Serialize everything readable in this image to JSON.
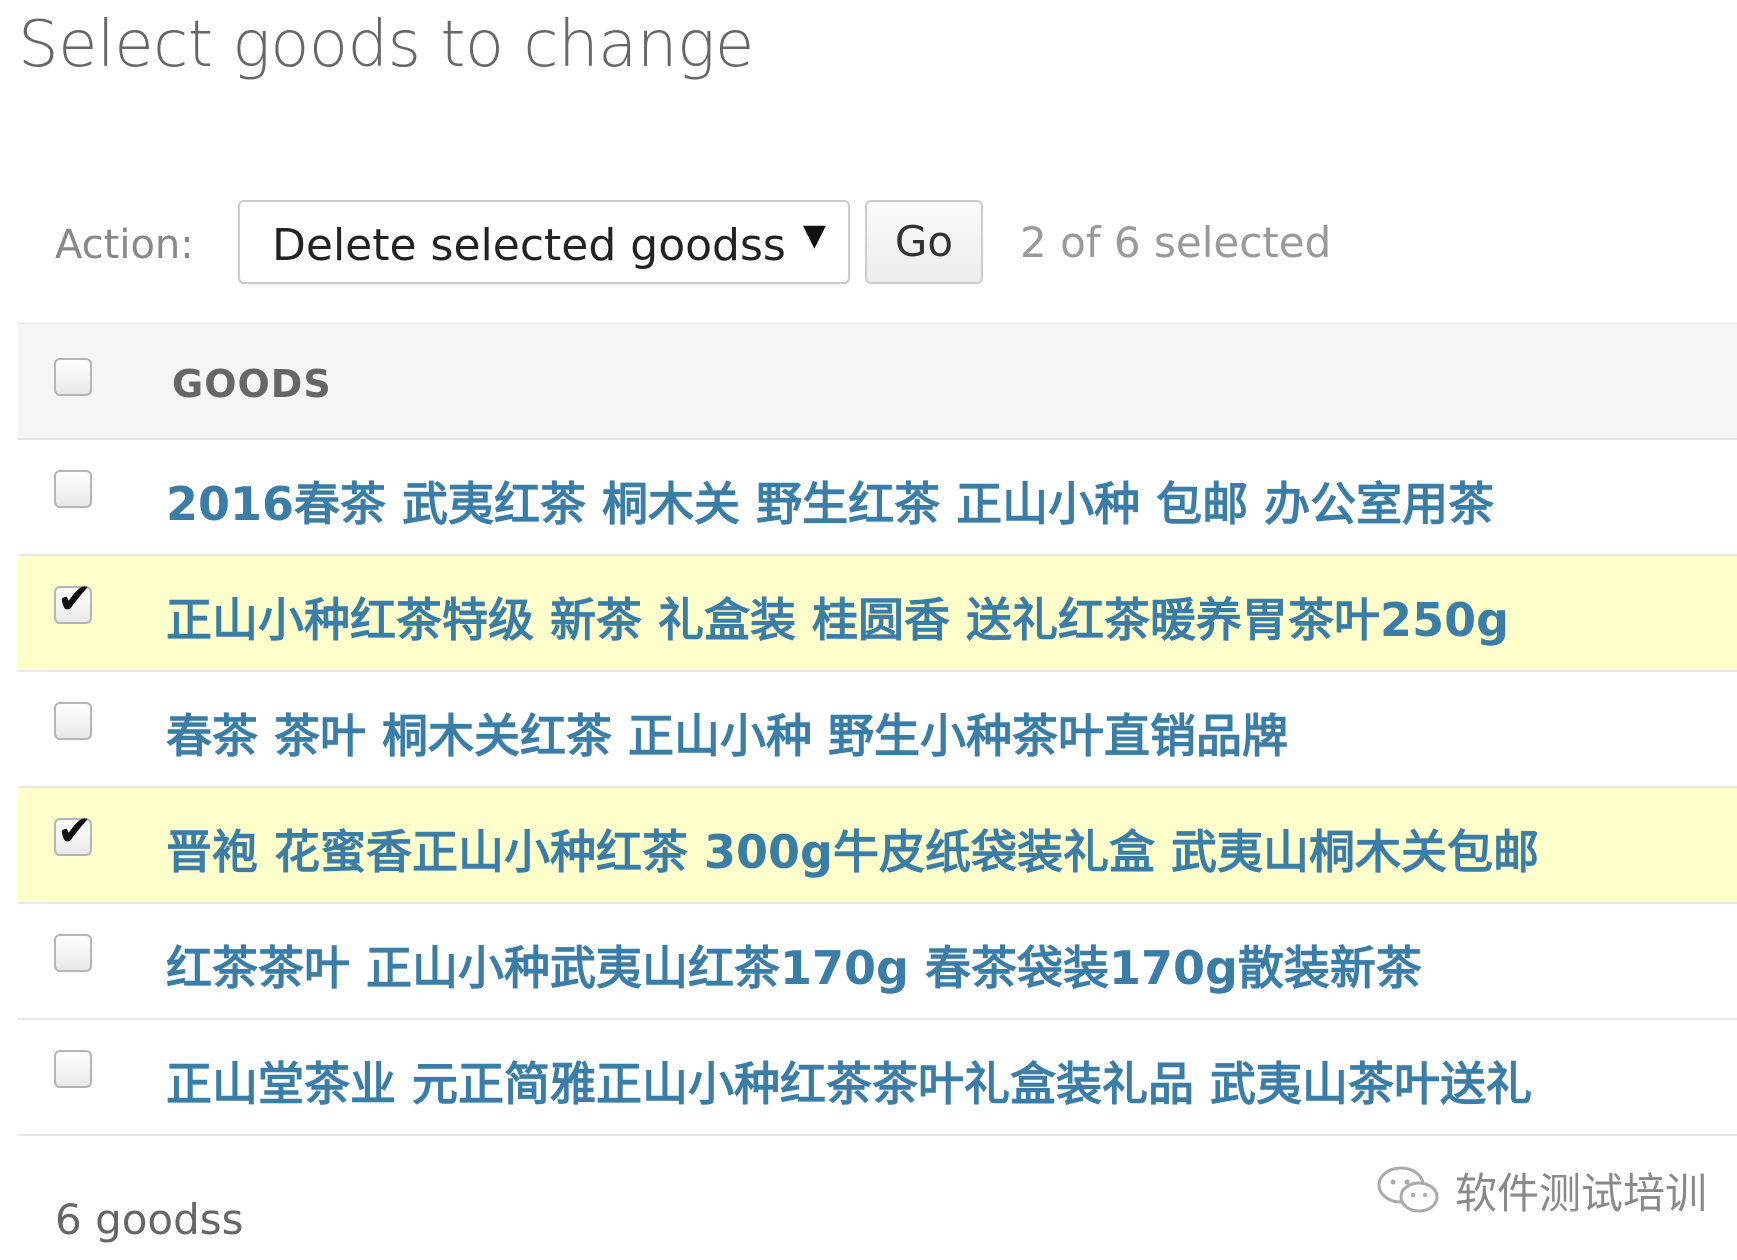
{
  "page": {
    "title": "Select goods to change"
  },
  "actions": {
    "label": "Action:",
    "selected_action": "Delete selected goodss",
    "go_label": "Go",
    "selection_counter": "2 of 6 selected"
  },
  "table": {
    "header": {
      "column_label": "GOODS",
      "select_all_checked": false
    },
    "rows": [
      {
        "title": "2016春茶 武夷红茶 桐木关 野生红茶 正山小种 包邮 办公室用茶",
        "checked": false
      },
      {
        "title": "正山小种红茶特级 新茶 礼盒装 桂圆香 送礼红茶暖养胃茶叶250g",
        "checked": true
      },
      {
        "title": "春茶 茶叶 桐木关红茶 正山小种 野生小种茶叶直销品牌",
        "checked": false
      },
      {
        "title": "晋袍 花蜜香正山小种红茶 300g牛皮纸袋装礼盒 武夷山桐木关包邮",
        "checked": true
      },
      {
        "title": "红茶茶叶 正山小种武夷山红茶170g 春茶袋装170g散装新茶",
        "checked": false
      },
      {
        "title": "正山堂茶业 元正简雅正山小种红茶茶叶礼盒装礼品 武夷山茶叶送礼",
        "checked": false
      }
    ]
  },
  "footer": {
    "result_count": "6 goodss"
  },
  "watermark": {
    "icon": "wechat-icon",
    "text": "软件测试培训"
  },
  "colors": {
    "link": "#3a7ea8",
    "selected_row": "#ffffcc",
    "header_bg": "#f5f5f5"
  }
}
